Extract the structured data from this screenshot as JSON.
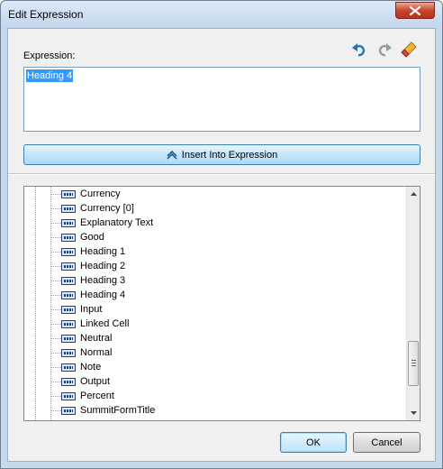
{
  "window": {
    "title": "Edit Expression"
  },
  "expression": {
    "label": "Expression:",
    "value": "Heading 4"
  },
  "toolbar": {
    "undo_icon": "undo-icon",
    "redo_icon": "redo-icon",
    "clear_icon": "eraser-icon"
  },
  "insert_button": {
    "label": "Insert Into Expression",
    "icon": "chevron-up-icon"
  },
  "tree": {
    "items": [
      {
        "label": "Currency"
      },
      {
        "label": "Currency [0]"
      },
      {
        "label": "Explanatory Text"
      },
      {
        "label": "Good"
      },
      {
        "label": "Heading 1"
      },
      {
        "label": "Heading 2"
      },
      {
        "label": "Heading 3"
      },
      {
        "label": "Heading 4"
      },
      {
        "label": "Input"
      },
      {
        "label": "Linked Cell"
      },
      {
        "label": "Neutral"
      },
      {
        "label": "Normal"
      },
      {
        "label": "Note"
      },
      {
        "label": "Output"
      },
      {
        "label": "Percent"
      },
      {
        "label": "SummitFormTitle"
      }
    ]
  },
  "footer": {
    "ok_label": "OK",
    "cancel_label": "Cancel"
  },
  "colors": {
    "selection": "#3399ff",
    "accent_border": "#3c7fb1",
    "close_red": "#c9452e"
  }
}
